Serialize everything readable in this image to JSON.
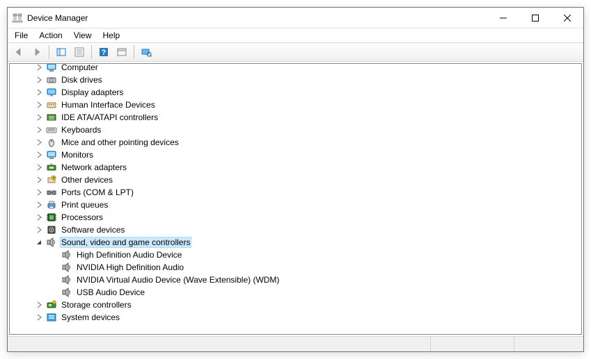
{
  "window": {
    "title": "Device Manager"
  },
  "menubar": [
    "File",
    "Action",
    "View",
    "Help"
  ],
  "tree": [
    {
      "level": 1,
      "expander": "closed",
      "icon": "computer",
      "label": "Computer"
    },
    {
      "level": 1,
      "expander": "closed",
      "icon": "disk",
      "label": "Disk drives"
    },
    {
      "level": 1,
      "expander": "closed",
      "icon": "display",
      "label": "Display adapters"
    },
    {
      "level": 1,
      "expander": "closed",
      "icon": "hid",
      "label": "Human Interface Devices"
    },
    {
      "level": 1,
      "expander": "closed",
      "icon": "ide",
      "label": "IDE ATA/ATAPI controllers"
    },
    {
      "level": 1,
      "expander": "closed",
      "icon": "keyboard",
      "label": "Keyboards"
    },
    {
      "level": 1,
      "expander": "closed",
      "icon": "mouse",
      "label": "Mice and other pointing devices"
    },
    {
      "level": 1,
      "expander": "closed",
      "icon": "monitor",
      "label": "Monitors"
    },
    {
      "level": 1,
      "expander": "closed",
      "icon": "network",
      "label": "Network adapters"
    },
    {
      "level": 1,
      "expander": "closed",
      "icon": "other",
      "label": "Other devices"
    },
    {
      "level": 1,
      "expander": "closed",
      "icon": "ports",
      "label": "Ports (COM & LPT)"
    },
    {
      "level": 1,
      "expander": "closed",
      "icon": "printer",
      "label": "Print queues"
    },
    {
      "level": 1,
      "expander": "closed",
      "icon": "cpu",
      "label": "Processors"
    },
    {
      "level": 1,
      "expander": "closed",
      "icon": "software",
      "label": "Software devices"
    },
    {
      "level": 1,
      "expander": "open",
      "icon": "audio",
      "label": "Sound, video and game controllers",
      "selected": true
    },
    {
      "level": 2,
      "expander": "none",
      "icon": "audio",
      "label": "High Definition Audio Device"
    },
    {
      "level": 2,
      "expander": "none",
      "icon": "audio",
      "label": "NVIDIA High Definition Audio"
    },
    {
      "level": 2,
      "expander": "none",
      "icon": "audio",
      "label": "NVIDIA Virtual Audio Device (Wave Extensible) (WDM)"
    },
    {
      "level": 2,
      "expander": "none",
      "icon": "audio",
      "label": "USB Audio Device"
    },
    {
      "level": 1,
      "expander": "closed",
      "icon": "storage",
      "label": "Storage controllers"
    },
    {
      "level": 1,
      "expander": "closed",
      "icon": "system",
      "label": "System devices"
    }
  ]
}
